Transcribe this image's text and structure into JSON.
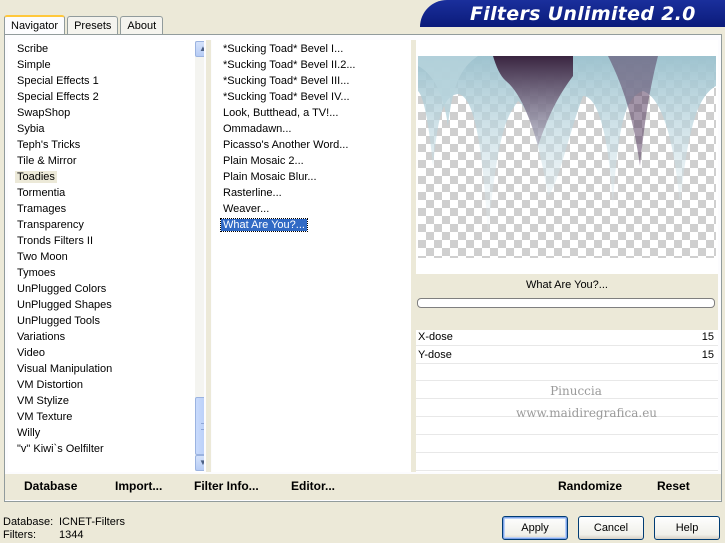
{
  "tabs": [
    "Navigator",
    "Presets",
    "About"
  ],
  "banner_title": "Filters Unlimited 2.0",
  "categories": [
    "Scribe",
    "Simple",
    "Special Effects 1",
    "Special Effects 2",
    "SwapShop",
    "Sybia",
    "Teph's Tricks",
    "Tile & Mirror",
    "Toadies",
    "Tormentia",
    "Tramages",
    "Transparency",
    "Tronds Filters II",
    "Two Moon",
    "Tymoes",
    "UnPlugged Colors",
    "UnPlugged Shapes",
    "UnPlugged Tools",
    "Variations",
    "Video",
    "Visual Manipulation",
    "VM Distortion",
    "VM Stylize",
    "VM Texture",
    "Willy",
    "\"v\" Kiwi`s Oelfilter"
  ],
  "selected_category": "Toadies",
  "filters": [
    "*Sucking Toad*  Bevel I...",
    "*Sucking Toad*  Bevel II.2...",
    "*Sucking Toad*  Bevel III...",
    "*Sucking Toad*  Bevel IV...",
    "Look, Butthead, a TV!...",
    "Ommadawn...",
    "Picasso's Another Word...",
    "Plain Mosaic 2...",
    "Plain Mosaic Blur...",
    "Rasterline...",
    "Weaver...",
    "What Are You?..."
  ],
  "selected_filter": "What Are You?...",
  "preview": {
    "filter_name": "What Are You?...",
    "progress": 0
  },
  "params": [
    {
      "label": "X-dose",
      "value": "15"
    },
    {
      "label": "Y-dose",
      "value": "15"
    }
  ],
  "watermark": {
    "line1": "Pinuccia",
    "line2": "www.maidiregrafica.eu"
  },
  "toolbar": {
    "database": "Database",
    "import": "Import...",
    "filter_info": "Filter Info...",
    "editor": "Editor...",
    "randomize": "Randomize",
    "reset": "Reset"
  },
  "status": {
    "database_label": "Database:",
    "database_value": "ICNET-Filters",
    "filters_label": "Filters:",
    "filters_value": "1344"
  },
  "buttons": {
    "apply": "Apply",
    "cancel": "Cancel",
    "help": "Help"
  },
  "colors": {
    "banner": "#0b1b7a",
    "selection": "#316ac5",
    "face": "#ece9d8"
  }
}
